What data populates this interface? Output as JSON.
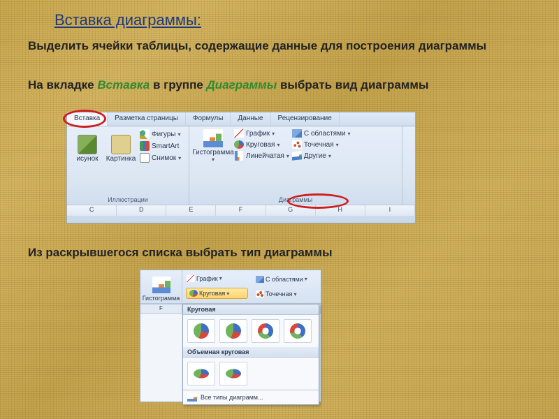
{
  "title": "Вставка диаграммы:",
  "para1": "Выделить ячейки таблицы, содержащие данные для построения диаграммы",
  "para2_a": "На вкладке ",
  "para2_b": "Вставка",
  "para2_c": " в группе ",
  "para2_d": "Диаграммы",
  "para2_e": " выбрать вид диаграммы",
  "para3": "Из раскрывшегося списка выбрать тип диаграммы",
  "ribbon": {
    "tabs": [
      "Вставка",
      "Разметка страницы",
      "Формулы",
      "Данные",
      "Рецензирование"
    ],
    "illustrations": {
      "big": [
        {
          "label": "исунок"
        },
        {
          "label": "Картинка"
        }
      ],
      "small": [
        "Фигуры",
        "SmartArt",
        "Снимок"
      ],
      "group_label": "Иллюстрации"
    },
    "charts": {
      "big": {
        "label": "Гистограмма"
      },
      "small": [
        "График",
        "Круговая",
        "Линейчатая",
        "С областями",
        "Точечная",
        "Другие"
      ],
      "group_label": "Диаграммы"
    },
    "cols": [
      "C",
      "D",
      "E",
      "F",
      "G",
      "H",
      "I"
    ]
  },
  "dropdown": {
    "big": "Гистограмма",
    "top": [
      "График",
      "Круговая",
      "С областями",
      "Точечная"
    ],
    "col_f": "F",
    "cat1": "Круговая",
    "cat2": "Объемная круговая",
    "all": "Все типы диаграмм..."
  }
}
